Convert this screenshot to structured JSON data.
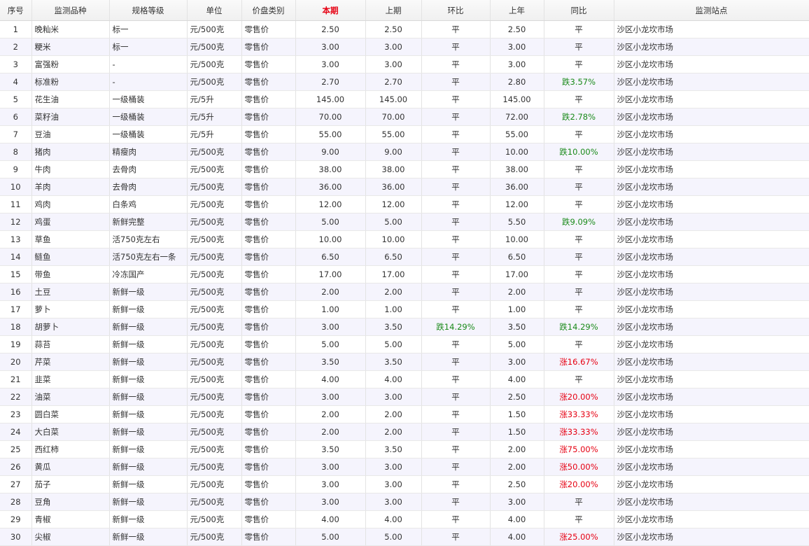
{
  "colors": {
    "header_current": "#e60012",
    "down": "#1a8a1a",
    "up": "#e60012",
    "row_alt": "#f5f4fd"
  },
  "headers": {
    "no": "序号",
    "item": "监测品种",
    "grade": "规格等级",
    "unit": "单位",
    "price_type": "价盘类别",
    "current": "本期",
    "previous": "上期",
    "mom": "环比",
    "last_year": "上年",
    "yoy": "同比",
    "site": "监测站点"
  },
  "rows": [
    {
      "no": "1",
      "item": "晚籼米",
      "grade": "标一",
      "unit": "元/500克",
      "type": "零售价",
      "current": "2.50",
      "previous": "2.50",
      "mom": "平",
      "last_year": "2.50",
      "yoy": "平",
      "site": "沙区小龙坎市场"
    },
    {
      "no": "2",
      "item": "粳米",
      "grade": "标一",
      "unit": "元/500克",
      "type": "零售价",
      "current": "3.00",
      "previous": "3.00",
      "mom": "平",
      "last_year": "3.00",
      "yoy": "平",
      "site": "沙区小龙坎市场"
    },
    {
      "no": "3",
      "item": "富强粉",
      "grade": "-",
      "unit": "元/500克",
      "type": "零售价",
      "current": "3.00",
      "previous": "3.00",
      "mom": "平",
      "last_year": "3.00",
      "yoy": "平",
      "site": "沙区小龙坎市场"
    },
    {
      "no": "4",
      "item": "标准粉",
      "grade": "-",
      "unit": "元/500克",
      "type": "零售价",
      "current": "2.70",
      "previous": "2.70",
      "mom": "平",
      "last_year": "2.80",
      "yoy": "跌3.57%",
      "site": "沙区小龙坎市场"
    },
    {
      "no": "5",
      "item": "花生油",
      "grade": "一级桶装",
      "unit": "元/5升",
      "type": "零售价",
      "current": "145.00",
      "previous": "145.00",
      "mom": "平",
      "last_year": "145.00",
      "yoy": "平",
      "site": "沙区小龙坎市场"
    },
    {
      "no": "6",
      "item": "菜籽油",
      "grade": "一级桶装",
      "unit": "元/5升",
      "type": "零售价",
      "current": "70.00",
      "previous": "70.00",
      "mom": "平",
      "last_year": "72.00",
      "yoy": "跌2.78%",
      "site": "沙区小龙坎市场"
    },
    {
      "no": "7",
      "item": "豆油",
      "grade": "一级桶装",
      "unit": "元/5升",
      "type": "零售价",
      "current": "55.00",
      "previous": "55.00",
      "mom": "平",
      "last_year": "55.00",
      "yoy": "平",
      "site": "沙区小龙坎市场"
    },
    {
      "no": "8",
      "item": "猪肉",
      "grade": "精瘦肉",
      "unit": "元/500克",
      "type": "零售价",
      "current": "9.00",
      "previous": "9.00",
      "mom": "平",
      "last_year": "10.00",
      "yoy": "跌10.00%",
      "site": "沙区小龙坎市场"
    },
    {
      "no": "9",
      "item": "牛肉",
      "grade": "去骨肉",
      "unit": "元/500克",
      "type": "零售价",
      "current": "38.00",
      "previous": "38.00",
      "mom": "平",
      "last_year": "38.00",
      "yoy": "平",
      "site": "沙区小龙坎市场"
    },
    {
      "no": "10",
      "item": "羊肉",
      "grade": "去骨肉",
      "unit": "元/500克",
      "type": "零售价",
      "current": "36.00",
      "previous": "36.00",
      "mom": "平",
      "last_year": "36.00",
      "yoy": "平",
      "site": "沙区小龙坎市场"
    },
    {
      "no": "11",
      "item": "鸡肉",
      "grade": "白条鸡",
      "unit": "元/500克",
      "type": "零售价",
      "current": "12.00",
      "previous": "12.00",
      "mom": "平",
      "last_year": "12.00",
      "yoy": "平",
      "site": "沙区小龙坎市场"
    },
    {
      "no": "12",
      "item": "鸡蛋",
      "grade": "新鲜完整",
      "unit": "元/500克",
      "type": "零售价",
      "current": "5.00",
      "previous": "5.00",
      "mom": "平",
      "last_year": "5.50",
      "yoy": "跌9.09%",
      "site": "沙区小龙坎市场"
    },
    {
      "no": "13",
      "item": "草鱼",
      "grade": "活750克左右",
      "unit": "元/500克",
      "type": "零售价",
      "current": "10.00",
      "previous": "10.00",
      "mom": "平",
      "last_year": "10.00",
      "yoy": "平",
      "site": "沙区小龙坎市场"
    },
    {
      "no": "14",
      "item": "鲢鱼",
      "grade": "活750克左右一条",
      "unit": "元/500克",
      "type": "零售价",
      "current": "6.50",
      "previous": "6.50",
      "mom": "平",
      "last_year": "6.50",
      "yoy": "平",
      "site": "沙区小龙坎市场"
    },
    {
      "no": "15",
      "item": "带鱼",
      "grade": "冷冻国产",
      "unit": "元/500克",
      "type": "零售价",
      "current": "17.00",
      "previous": "17.00",
      "mom": "平",
      "last_year": "17.00",
      "yoy": "平",
      "site": "沙区小龙坎市场"
    },
    {
      "no": "16",
      "item": "土豆",
      "grade": "新鲜一级",
      "unit": "元/500克",
      "type": "零售价",
      "current": "2.00",
      "previous": "2.00",
      "mom": "平",
      "last_year": "2.00",
      "yoy": "平",
      "site": "沙区小龙坎市场"
    },
    {
      "no": "17",
      "item": "萝卜",
      "grade": "新鲜一级",
      "unit": "元/500克",
      "type": "零售价",
      "current": "1.00",
      "previous": "1.00",
      "mom": "平",
      "last_year": "1.00",
      "yoy": "平",
      "site": "沙区小龙坎市场"
    },
    {
      "no": "18",
      "item": "胡萝卜",
      "grade": "新鲜一级",
      "unit": "元/500克",
      "type": "零售价",
      "current": "3.00",
      "previous": "3.50",
      "mom": "跌14.29%",
      "last_year": "3.50",
      "yoy": "跌14.29%",
      "site": "沙区小龙坎市场"
    },
    {
      "no": "19",
      "item": "蒜苔",
      "grade": "新鲜一级",
      "unit": "元/500克",
      "type": "零售价",
      "current": "5.00",
      "previous": "5.00",
      "mom": "平",
      "last_year": "5.00",
      "yoy": "平",
      "site": "沙区小龙坎市场"
    },
    {
      "no": "20",
      "item": "芹菜",
      "grade": "新鲜一级",
      "unit": "元/500克",
      "type": "零售价",
      "current": "3.50",
      "previous": "3.50",
      "mom": "平",
      "last_year": "3.00",
      "yoy": "涨16.67%",
      "site": "沙区小龙坎市场"
    },
    {
      "no": "21",
      "item": "韭菜",
      "grade": "新鲜一级",
      "unit": "元/500克",
      "type": "零售价",
      "current": "4.00",
      "previous": "4.00",
      "mom": "平",
      "last_year": "4.00",
      "yoy": "平",
      "site": "沙区小龙坎市场"
    },
    {
      "no": "22",
      "item": "油菜",
      "grade": "新鲜一级",
      "unit": "元/500克",
      "type": "零售价",
      "current": "3.00",
      "previous": "3.00",
      "mom": "平",
      "last_year": "2.50",
      "yoy": "涨20.00%",
      "site": "沙区小龙坎市场"
    },
    {
      "no": "23",
      "item": "圆白菜",
      "grade": "新鲜一级",
      "unit": "元/500克",
      "type": "零售价",
      "current": "2.00",
      "previous": "2.00",
      "mom": "平",
      "last_year": "1.50",
      "yoy": "涨33.33%",
      "site": "沙区小龙坎市场"
    },
    {
      "no": "24",
      "item": "大白菜",
      "grade": "新鲜一级",
      "unit": "元/500克",
      "type": "零售价",
      "current": "2.00",
      "previous": "2.00",
      "mom": "平",
      "last_year": "1.50",
      "yoy": "涨33.33%",
      "site": "沙区小龙坎市场"
    },
    {
      "no": "25",
      "item": "西红柿",
      "grade": "新鲜一级",
      "unit": "元/500克",
      "type": "零售价",
      "current": "3.50",
      "previous": "3.50",
      "mom": "平",
      "last_year": "2.00",
      "yoy": "涨75.00%",
      "site": "沙区小龙坎市场"
    },
    {
      "no": "26",
      "item": "黄瓜",
      "grade": "新鲜一级",
      "unit": "元/500克",
      "type": "零售价",
      "current": "3.00",
      "previous": "3.00",
      "mom": "平",
      "last_year": "2.00",
      "yoy": "涨50.00%",
      "site": "沙区小龙坎市场"
    },
    {
      "no": "27",
      "item": "茄子",
      "grade": "新鲜一级",
      "unit": "元/500克",
      "type": "零售价",
      "current": "3.00",
      "previous": "3.00",
      "mom": "平",
      "last_year": "2.50",
      "yoy": "涨20.00%",
      "site": "沙区小龙坎市场"
    },
    {
      "no": "28",
      "item": "豆角",
      "grade": "新鲜一级",
      "unit": "元/500克",
      "type": "零售价",
      "current": "3.00",
      "previous": "3.00",
      "mom": "平",
      "last_year": "3.00",
      "yoy": "平",
      "site": "沙区小龙坎市场"
    },
    {
      "no": "29",
      "item": "青椒",
      "grade": "新鲜一级",
      "unit": "元/500克",
      "type": "零售价",
      "current": "4.00",
      "previous": "4.00",
      "mom": "平",
      "last_year": "4.00",
      "yoy": "平",
      "site": "沙区小龙坎市场"
    },
    {
      "no": "30",
      "item": "尖椒",
      "grade": "新鲜一级",
      "unit": "元/500克",
      "type": "零售价",
      "current": "5.00",
      "previous": "5.00",
      "mom": "平",
      "last_year": "4.00",
      "yoy": "涨25.00%",
      "site": "沙区小龙坎市场"
    }
  ]
}
